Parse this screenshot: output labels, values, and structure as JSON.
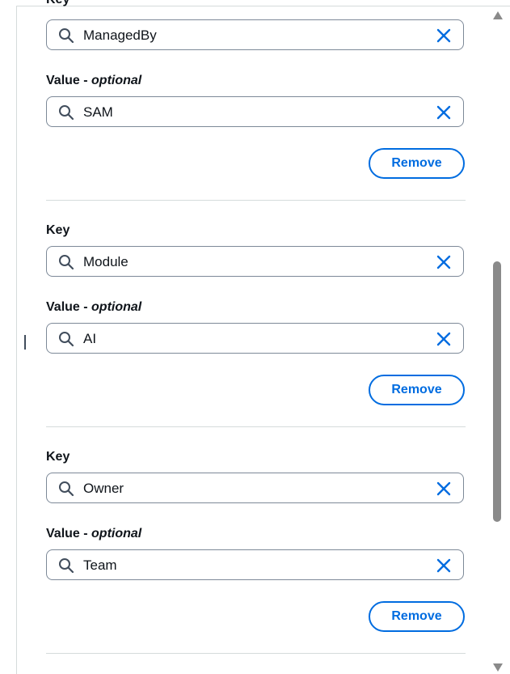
{
  "tags": [
    {
      "key_label": "Key",
      "key_value": "ManagedBy",
      "value_label": "Value",
      "value_optional": "optional",
      "value_value": "SAM",
      "remove_label": "Remove"
    },
    {
      "key_label": "Key",
      "key_value": "Module",
      "value_label": "Value",
      "value_optional": "optional",
      "value_value": "AI",
      "remove_label": "Remove"
    },
    {
      "key_label": "Key",
      "key_value": "Owner",
      "value_label": "Value",
      "value_optional": "optional",
      "value_value": "Team",
      "remove_label": "Remove"
    }
  ],
  "label_separator": " - ",
  "colors": {
    "accent": "#006ce0",
    "text": "#0f141a",
    "field_border": "#7d8998",
    "divider": "#d5dbdb",
    "icon": "#414d5c"
  },
  "icons": {
    "search": "search-icon",
    "clear": "close-icon"
  }
}
